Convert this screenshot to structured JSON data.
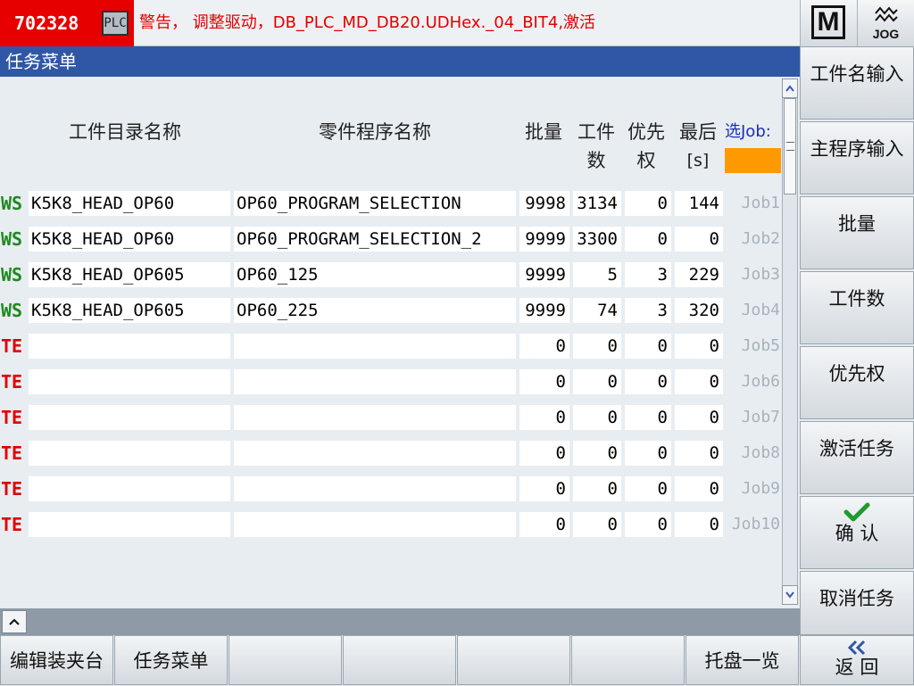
{
  "alarm": {
    "number": "702328",
    "source_badge": "PLC",
    "message": "警告，  调整驱动，DB_PLC_MD_DB20.UDHex._04_BIT4,激活"
  },
  "mode": {
    "machine_icon_label": "M",
    "jog_label": "JOG"
  },
  "title": "任务菜单",
  "columns": {
    "workpiece_dir": "工件目录名称",
    "part_program": "零件程序名称",
    "batch": "批量",
    "count_line1": "工件",
    "count_line2": "数",
    "priority_line1": "优先",
    "priority_line2": "权",
    "last_line1": "最后",
    "last_line2": "[s]",
    "select_job": "选Job:"
  },
  "colors": {
    "ws_tag": "#1e8a1e",
    "te_tag": "#e00000",
    "select_job_bar": "#ff9900",
    "title_bar": "#2f57a6",
    "alarm_bg": "#e60000"
  },
  "rows": [
    {
      "tag": "WS",
      "dir": "K5K8_HEAD_OP60",
      "program": "OP60_PROGRAM_SELECTION",
      "batch": "9998",
      "count": "3134",
      "priority": "0",
      "last": "144",
      "job": "Job1"
    },
    {
      "tag": "WS",
      "dir": "K5K8_HEAD_OP60",
      "program": "OP60_PROGRAM_SELECTION_2",
      "batch": "9999",
      "count": "3300",
      "priority": "0",
      "last": "0",
      "job": "Job2"
    },
    {
      "tag": "WS",
      "dir": "K5K8_HEAD_OP605",
      "program": "OP60_125",
      "batch": "9999",
      "count": "5",
      "priority": "3",
      "last": "229",
      "job": "Job3"
    },
    {
      "tag": "WS",
      "dir": "K5K8_HEAD_OP605",
      "program": "OP60_225",
      "batch": "9999",
      "count": "74",
      "priority": "3",
      "last": "320",
      "job": "Job4"
    },
    {
      "tag": "TE",
      "dir": "",
      "program": "",
      "batch": "0",
      "count": "0",
      "priority": "0",
      "last": "0",
      "job": "Job5"
    },
    {
      "tag": "TE",
      "dir": "",
      "program": "",
      "batch": "0",
      "count": "0",
      "priority": "0",
      "last": "0",
      "job": "Job6"
    },
    {
      "tag": "TE",
      "dir": "",
      "program": "",
      "batch": "0",
      "count": "0",
      "priority": "0",
      "last": "0",
      "job": "Job7"
    },
    {
      "tag": "TE",
      "dir": "",
      "program": "",
      "batch": "0",
      "count": "0",
      "priority": "0",
      "last": "0",
      "job": "Job8"
    },
    {
      "tag": "TE",
      "dir": "",
      "program": "",
      "batch": "0",
      "count": "0",
      "priority": "0",
      "last": "0",
      "job": "Job9"
    },
    {
      "tag": "TE",
      "dir": "",
      "program": "",
      "batch": "0",
      "count": "0",
      "priority": "0",
      "last": "0",
      "job": "Job10"
    }
  ],
  "vertical_softkeys": [
    {
      "label": "工件名输入"
    },
    {
      "label": "主程序输入"
    },
    {
      "label": "批量"
    },
    {
      "label": "工件数"
    },
    {
      "label": "优先权"
    },
    {
      "label": "激活任务"
    },
    {
      "label": "确 认",
      "icon": "checkmark-icon"
    },
    {
      "label": "取消任务"
    }
  ],
  "horizontal_softkeys": [
    {
      "label": "编辑装夹台"
    },
    {
      "label": "任务菜单"
    },
    {
      "label": ""
    },
    {
      "label": ""
    },
    {
      "label": ""
    },
    {
      "label": ""
    },
    {
      "label": "托盘一览"
    },
    {
      "label": "返 回",
      "icon": "double-chevron-left-icon"
    }
  ]
}
